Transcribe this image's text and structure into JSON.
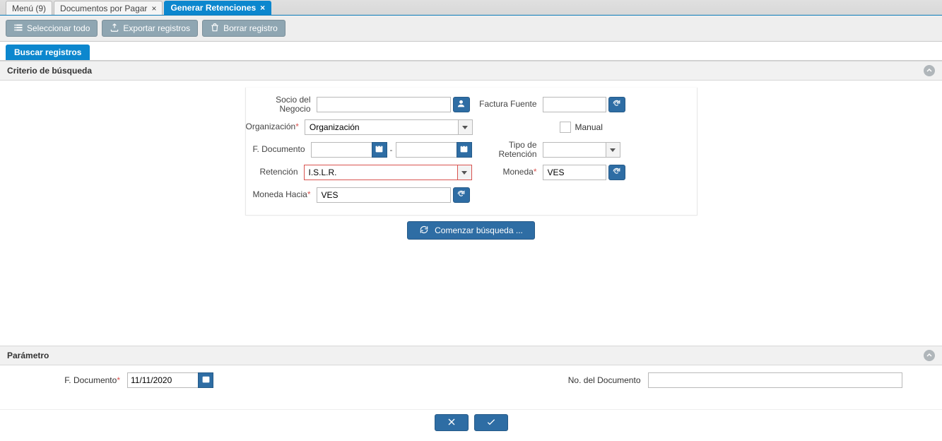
{
  "tabs": {
    "menu": "Menú (9)",
    "docs": "Documentos por Pagar",
    "active": "Generar Retenciones"
  },
  "toolbar": {
    "select_all": "Seleccionar todo",
    "export": "Exportar registros",
    "delete": "Borrar registro"
  },
  "subtab": {
    "search": "Buscar registros"
  },
  "criteria": {
    "title": "Criterio de búsqueda",
    "labels": {
      "socio": "Socio del Negocio",
      "factura": "Factura Fuente",
      "org": "Organización",
      "manual": "Manual",
      "fdoc": "F. Documento",
      "tipo_ret": "Tipo de Retención",
      "retencion": "Retención",
      "moneda": "Moneda",
      "moneda_hacia": "Moneda Hacia"
    },
    "values": {
      "socio": "",
      "factura": "",
      "org": "Organización",
      "fdoc_from": "",
      "fdoc_to": "",
      "tipo_ret": "",
      "retencion": "I.S.L.R.",
      "moneda": "VES",
      "moneda_hacia": "VES",
      "manual_checked": false
    },
    "search_btn": "Comenzar búsqueda ..."
  },
  "parametro": {
    "title": "Parámetro",
    "labels": {
      "fdoc": "F. Documento",
      "nodoc": "No. del Documento"
    },
    "values": {
      "fdoc": "11/11/2020",
      "nodoc": ""
    }
  }
}
